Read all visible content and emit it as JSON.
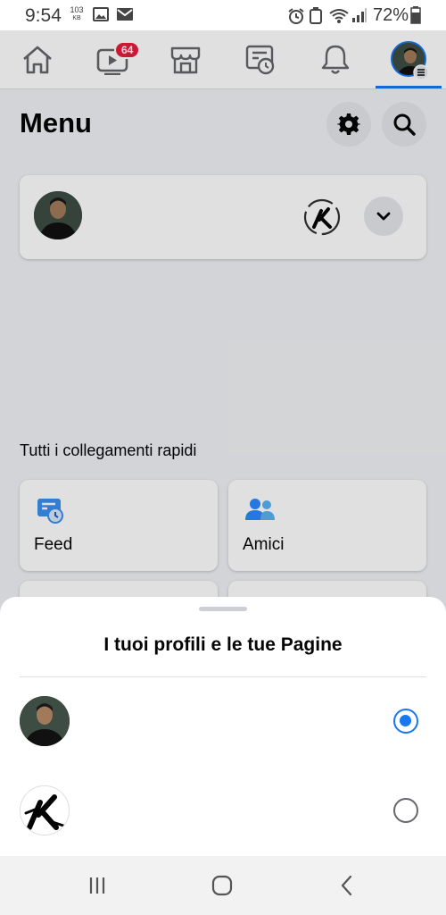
{
  "status_bar": {
    "time": "9:54",
    "data_rate": "103",
    "data_unit": "KB",
    "battery": "72%"
  },
  "nav": {
    "tabs": [
      {
        "icon": "home-icon"
      },
      {
        "icon": "watch-icon",
        "badge": "64"
      },
      {
        "icon": "marketplace-icon"
      },
      {
        "icon": "feed-icon"
      },
      {
        "icon": "bell-icon"
      },
      {
        "icon": "profile-menu-icon",
        "active": true
      }
    ],
    "accent": "#1877f2"
  },
  "menu": {
    "title": "Menu",
    "settings_icon": "gear-icon",
    "search_icon": "search-icon"
  },
  "shortcuts": {
    "section_label": "Tutti i collegamenti rapidi",
    "items": [
      {
        "label": "Feed",
        "icon": "feed-icon"
      },
      {
        "label": "Amici",
        "icon": "friends-icon"
      }
    ]
  },
  "sheet": {
    "title": "I tuoi profili e le tue Pagine",
    "profiles": [
      {
        "icon": "avatar",
        "selected": true
      },
      {
        "icon": "page-logo",
        "selected": false
      }
    ]
  }
}
